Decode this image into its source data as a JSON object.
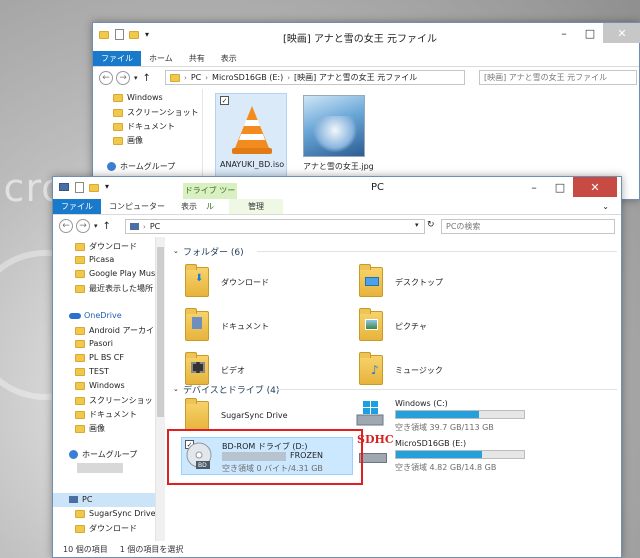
{
  "background": {
    "text": "icroso"
  },
  "back_window": {
    "title": "[映画] アナと雪の女王 元ファイル",
    "tabs": [
      "ファイル",
      "ホーム",
      "共有",
      "表示"
    ],
    "breadcrumb": [
      "PC",
      "MicroSD16GB (E:)",
      "[映画] アナと雪の女王 元ファイル"
    ],
    "search_placeholder": "[映画] アナと雪の女王 元ファイル",
    "nav": [
      "Windows",
      "スクリーンショット",
      "ドキュメント",
      "画像",
      "ホームグループ"
    ],
    "files": [
      {
        "name": "ANAYUKI_BD.iso",
        "icon": "vlc-cone-icon"
      },
      {
        "name": "アナと雪の女王.jpg",
        "icon": "frozen-thumbnail"
      }
    ]
  },
  "front_window": {
    "title": "PC",
    "contextual_tab": "ドライブ ツール",
    "tabs": [
      "ファイル",
      "コンピューター",
      "表示",
      "管理"
    ],
    "breadcrumb": [
      "PC"
    ],
    "search_placeholder": "PCの検索",
    "nav": {
      "quick": [
        "ダウンロード",
        "Picasa",
        "Google Play Mus",
        "最近表示した場所"
      ],
      "onedrive": "OneDrive",
      "onedrive_items": [
        "Android アーカイブ",
        "Pasori",
        "PL BS CF",
        "TEST",
        "Windows",
        "スクリーンショット",
        "ドキュメント",
        "画像"
      ],
      "homegroup": "ホームグループ",
      "pc": "PC",
      "pc_items": [
        "SugarSync Drive",
        "ダウンロード"
      ]
    },
    "folders_header": "フォルダー (6)",
    "folders": [
      "ダウンロード",
      "デスクトップ",
      "ドキュメント",
      "ピクチャ",
      "ビデオ",
      "ミュージック"
    ],
    "devices_header": "デバイスとドライブ (4)",
    "devices": [
      {
        "name": "SugarSync Drive"
      },
      {
        "name": "Windows (C:)",
        "free": "空き領域 39.7 GB/113 GB",
        "used_fraction": 0.65
      },
      {
        "name": "BD-ROM ドライブ (D:)",
        "label": "FROZEN",
        "free": "空き領域 0 バイト/4.31 GB",
        "disc_badge": "BD"
      },
      {
        "name": "MicroSD16GB (E:)",
        "free": "空き領域 4.82 GB/14.8 GB",
        "used_fraction": 0.67,
        "badge": "SDHC"
      }
    ],
    "status": {
      "count": "10 個の項目",
      "selected": "1 個の項目を選択"
    }
  },
  "colors": {
    "file_tab": "#1979ca",
    "bar_fill": "#26a0da",
    "highlight_box": "#e02020",
    "sdhc": "#d42222"
  }
}
